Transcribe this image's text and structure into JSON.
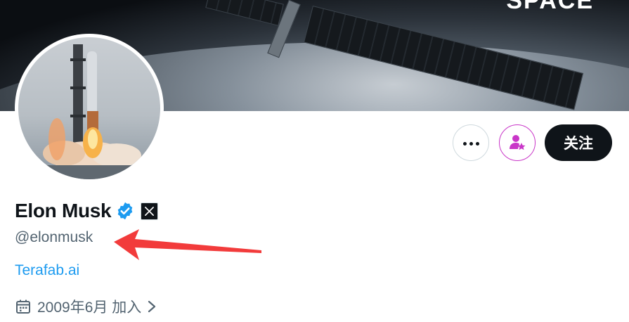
{
  "banner": {
    "text": "SPACE"
  },
  "profile": {
    "name": "Elon Musk",
    "handle": "@elonmusk",
    "website": "Terafab.ai",
    "joined": "2009年6月 加入"
  },
  "actions": {
    "follow_label": "关注"
  },
  "colors": {
    "accent": "#1d9bf0",
    "follow_bg": "#0f1419",
    "subscribe": "#c936c8",
    "annotation_arrow": "#f23b3b",
    "muted": "#536471"
  },
  "icons": {
    "more": "more-horizontal-icon",
    "subscribe": "person-star-icon",
    "verified": "verified-badge-icon",
    "affiliate": "x-logo-icon",
    "calendar": "calendar-icon",
    "chevron": "chevron-right-icon"
  }
}
